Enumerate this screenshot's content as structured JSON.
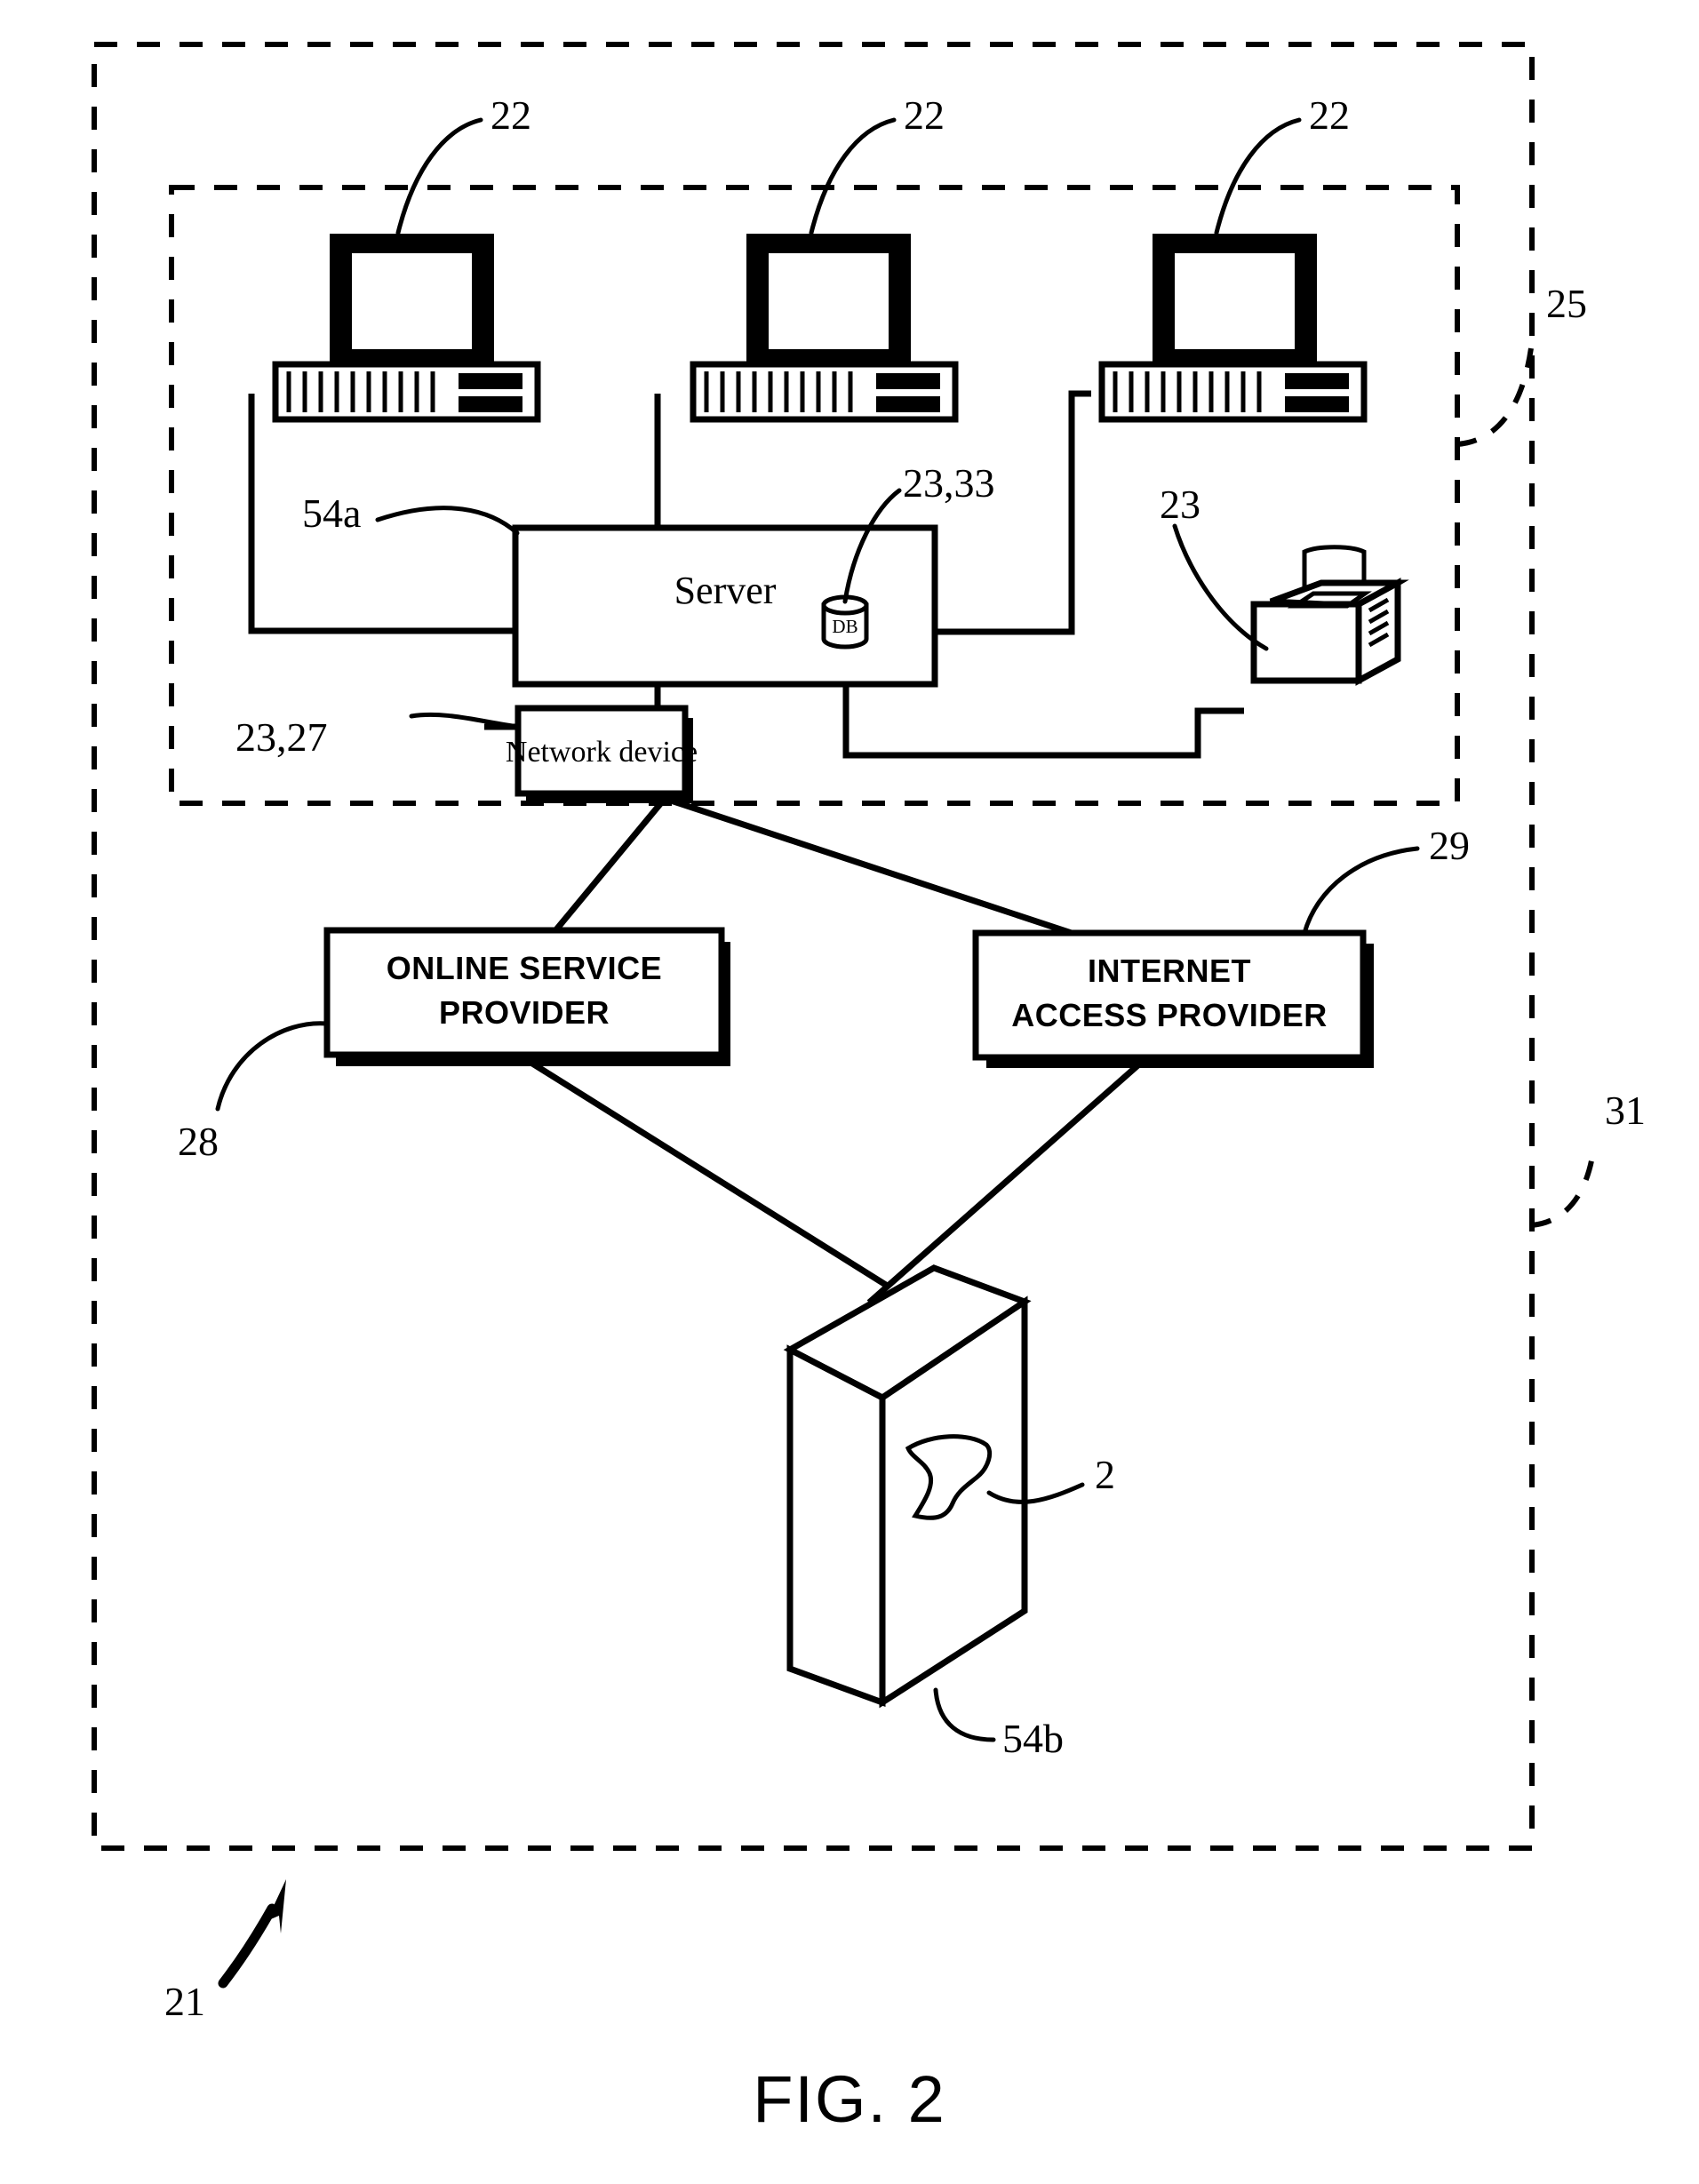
{
  "figure": {
    "caption": "FIG. 2",
    "title": "Network system block diagram"
  },
  "nodes": {
    "server": {
      "label": "Server",
      "db_label": "DB"
    },
    "network_device": {
      "label": "Network device"
    },
    "online_service_provider": {
      "line1": "ONLINE SERVICE",
      "line2": "PROVIDER"
    },
    "internet_access_provider": {
      "line1": "INTERNET",
      "line2": "ACCESS PROVIDER"
    }
  },
  "reference_numerals": {
    "workstation_left": "22",
    "workstation_center": "22",
    "workstation_right": "22",
    "inner_boundary": "25",
    "server_link": "54a",
    "database": "23,33",
    "printer": "23",
    "network_device": "23,27",
    "online_service_provider": "28",
    "internet_access_provider": "29",
    "outer_boundary": "31",
    "product_mark": "2",
    "product_box": "54b",
    "system": "21"
  },
  "colors": {
    "ink": "#000000",
    "paper": "#ffffff"
  },
  "icons": {
    "workstation": "desktop-computer-icon",
    "printer": "printer-icon",
    "database": "database-cylinder-icon",
    "product": "3d-package-box-icon",
    "arrow": "curved-arrow-icon"
  }
}
